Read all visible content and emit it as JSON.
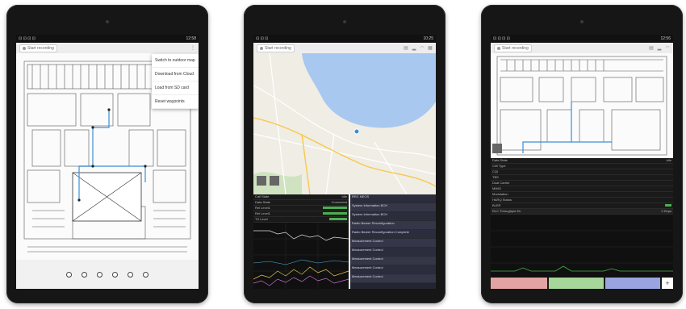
{
  "tablets": [
    {
      "status_time": "12:58",
      "record_label": "Start recording",
      "menu_items": [
        "Switch to outdoor map",
        "Download from Cloud",
        "Load from SD card",
        "Reset waypoints"
      ]
    },
    {
      "status_time": "10:25",
      "record_label": "Start recording",
      "info_rows": [
        {
          "label": "Call State",
          "value": "Idle"
        },
        {
          "label": "Data State",
          "value": "Connected"
        },
        {
          "label": "Rel Level1",
          "value": ""
        },
        {
          "label": "Rel Level1",
          "value": ""
        },
        {
          "label": "TX Level",
          "value": ""
        }
      ],
      "messages": [
        "RRC NEOS",
        "System Information BCH",
        "System Information BCH",
        "Radio Bearer Reconfiguration",
        "Radio Bearer Reconfiguration Complete",
        "Measurement Control",
        "Measurement Control",
        "Measurement Control",
        "Measurement Control",
        "Measurement Control",
        "Measurement Report",
        "Measurement Control",
        "Measurement Report"
      ]
    },
    {
      "status_time": "12:56",
      "record_label": "Start recording",
      "info_rows": [
        {
          "label": "Data State",
          "value": "Idle"
        },
        {
          "label": "Cell Type",
          "value": ""
        },
        {
          "label": "CQI",
          "value": ""
        },
        {
          "label": "TBS",
          "value": ""
        },
        {
          "label": "Dual Carrier",
          "value": ""
        },
        {
          "label": "MIMO",
          "value": ""
        },
        {
          "label": "Modulation",
          "value": ""
        },
        {
          "label": "HARQ Status",
          "value": ""
        },
        {
          "label": "BLER",
          "value": ""
        }
      ],
      "throughput_label": "RLC Throughput DL",
      "throughput_value": "0 Kbps"
    }
  ],
  "colors": {
    "bezel": "#161616",
    "water": "#a8c8f0",
    "land": "#f0ede5",
    "accent": "#3a8fd8"
  }
}
